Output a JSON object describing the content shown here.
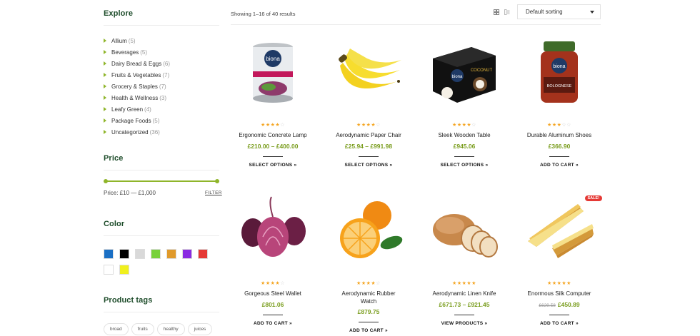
{
  "sidebar": {
    "explore_title": "Explore",
    "categories": [
      {
        "name": "Allium",
        "count": "(5)"
      },
      {
        "name": "Beverages",
        "count": "(5)"
      },
      {
        "name": "Dairy Bread & Eggs",
        "count": "(6)"
      },
      {
        "name": "Fruits & Vegetables",
        "count": "(7)"
      },
      {
        "name": "Grocery & Staples",
        "count": "(7)"
      },
      {
        "name": "Health & Wellness",
        "count": "(3)"
      },
      {
        "name": "Leafy Green",
        "count": "(4)"
      },
      {
        "name": "Package Foods",
        "count": "(5)"
      },
      {
        "name": "Uncategorized",
        "count": "(36)"
      }
    ],
    "price_title": "Price",
    "price_label": "Price: £10 — £1,000",
    "filter_label": "FILTER",
    "color_title": "Color",
    "colors": [
      "#1a6fc4",
      "#000000",
      "#d9d9d9",
      "#77d13a",
      "#e09a2b",
      "#8a2be2",
      "#e53935",
      "#ffffff",
      "#f0f01e"
    ],
    "tags_title": "Product tags",
    "tags": [
      "broad",
      "fruits",
      "healthy",
      "juices"
    ]
  },
  "shop": {
    "result_count": "Showing 1–16 of 40 results",
    "sort_label": "Default sorting"
  },
  "products": [
    {
      "name": "Ergonomic Concrete Lamp",
      "price": "£210.00 – £400.00",
      "old_price": "",
      "stars": 3.5,
      "button": "SELECT OPTIONS »",
      "sale": "",
      "image": "canned-product-icon"
    },
    {
      "name": "Aerodynamic Paper Chair",
      "price": "£25.94 – £991.98",
      "old_price": "",
      "stars": 4,
      "button": "SELECT OPTIONS »",
      "sale": "",
      "image": "banana-icon"
    },
    {
      "name": "Sleek Wooden Table",
      "price": "£945.06",
      "old_price": "",
      "stars": 4,
      "button": "SELECT OPTIONS »",
      "sale": "",
      "image": "coconut-milk-box-icon"
    },
    {
      "name": "Durable Aluminum Shoes",
      "price": "£366.90",
      "old_price": "",
      "stars": 3,
      "button": "ADD TO CART »",
      "sale": "",
      "image": "sauce-jar-icon"
    },
    {
      "name": "Gorgeous Steel Wallet",
      "price": "£801.06",
      "old_price": "",
      "stars": 3.5,
      "button": "ADD TO CART »",
      "sale": "",
      "image": "red-onion-icon"
    },
    {
      "name": "Aerodynamic Rubber Watch",
      "price": "£879.75",
      "old_price": "",
      "stars": 4,
      "button": "ADD TO CART »",
      "sale": "",
      "image": "orange-icon"
    },
    {
      "name": "Aerodynamic Linen Knife",
      "price": "£671.73 – £921.45",
      "old_price": "",
      "stars": 4.5,
      "button": "VIEW PRODUCTS »",
      "sale": "",
      "image": "bread-icon"
    },
    {
      "name": "Enormous Silk Computer",
      "price": "£450.89",
      "old_price": "£629.58",
      "stars": 4.5,
      "button": "ADD TO CART »",
      "sale": "SALE!",
      "image": "sandwich-icon"
    }
  ]
}
